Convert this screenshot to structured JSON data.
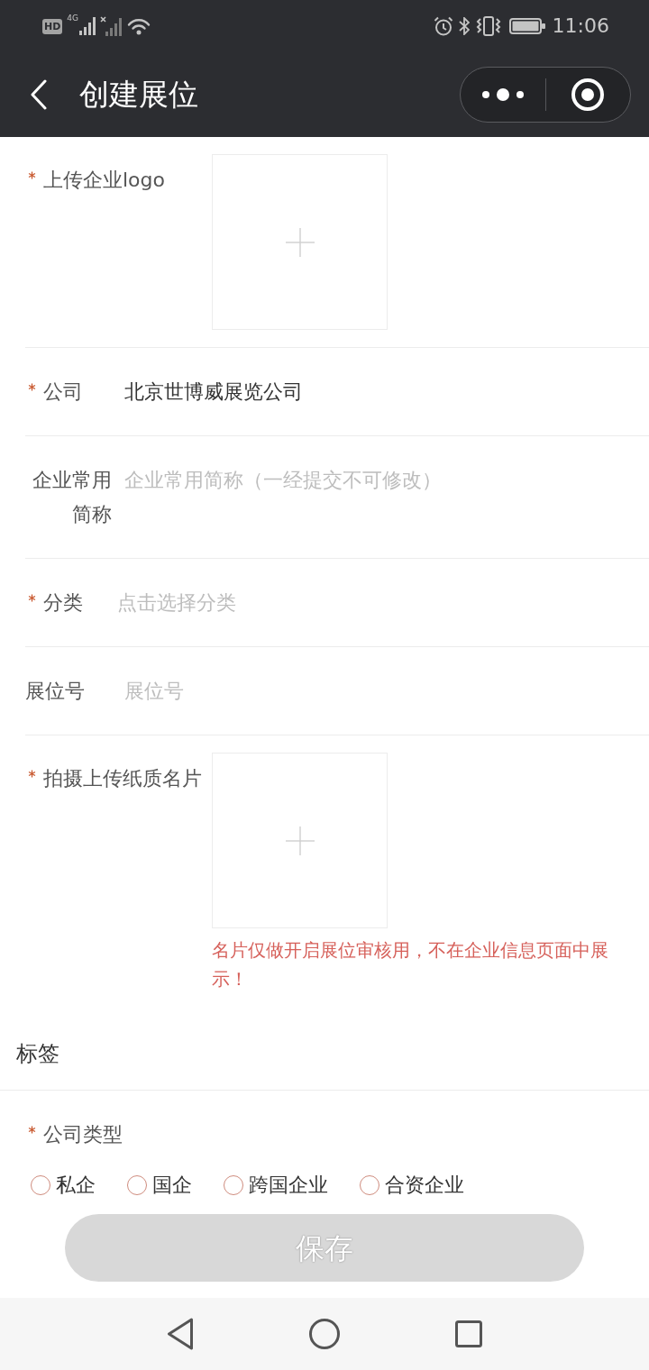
{
  "status_bar": {
    "hd_badge": "HD",
    "network": "4G",
    "time": "11:06"
  },
  "nav_bar": {
    "title": "创建展位"
  },
  "fields": [
    {
      "kind": "upload",
      "label": "上传企业logo",
      "required": true
    },
    {
      "kind": "text",
      "label": "公司",
      "required": true,
      "value": "北京世博威展览公司"
    },
    {
      "kind": "text",
      "label": "企业常用简称",
      "required": false,
      "placeholder": "企业常用简称（一经提交不可修改）"
    },
    {
      "kind": "picker",
      "label": "分类",
      "required": true,
      "placeholder": "点击选择分类"
    },
    {
      "kind": "text",
      "label": "展位号",
      "required": false,
      "placeholder": "展位号"
    },
    {
      "kind": "upload",
      "label": "拍摄上传纸质名片",
      "required": true,
      "note": "名片仅做开启展位审核用，不在企业信息页面中展示！"
    }
  ],
  "section": {
    "title": "标签"
  },
  "company_type": {
    "label": "公司类型",
    "required": true,
    "options": [
      {
        "label": "私企",
        "selected": false
      },
      {
        "label": "国企",
        "selected": false
      },
      {
        "label": "跨国企业",
        "selected": false
      },
      {
        "label": "合资企业",
        "selected": false
      }
    ]
  },
  "save_button": {
    "label": "保存",
    "disabled": true
  }
}
